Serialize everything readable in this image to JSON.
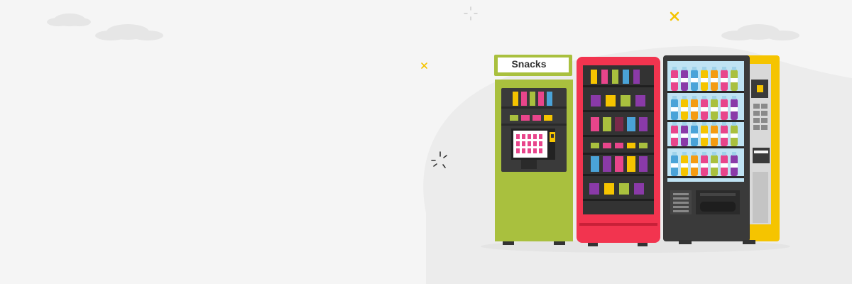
{
  "scene": {
    "background_color": "#f5f5f5",
    "blob_color": "#ececec",
    "cloud_color": "#e6e6e6"
  },
  "sparkles": [
    {
      "name": "x-sparkle-icon",
      "color": "#f5c400"
    },
    {
      "name": "x-sparkle-icon",
      "color": "#f5c400"
    },
    {
      "name": "burst-sparkle-icon",
      "color": "#333333"
    },
    {
      "name": "burst-sparkle-icon",
      "color": "#cccccc"
    }
  ],
  "machines": [
    {
      "id": "snack-kiosk",
      "sign_label": "Snacks",
      "body_color": "#a9c03e",
      "panel_color": "#3a3a3a",
      "accent_color": "#f5c400"
    },
    {
      "id": "candy-machine",
      "body_color": "#f2344f",
      "panel_color": "#333333"
    },
    {
      "id": "drinks-machine",
      "body_color": "#3a3a3a",
      "side_color": "#f5c400",
      "glass_color": "#bfe3f3"
    }
  ],
  "product_colors": [
    "#f5c400",
    "#e8458b",
    "#a9c03e",
    "#4aa3d8",
    "#8a3aa8",
    "#ffffff",
    "#7a2a4a",
    "#f39c12"
  ]
}
